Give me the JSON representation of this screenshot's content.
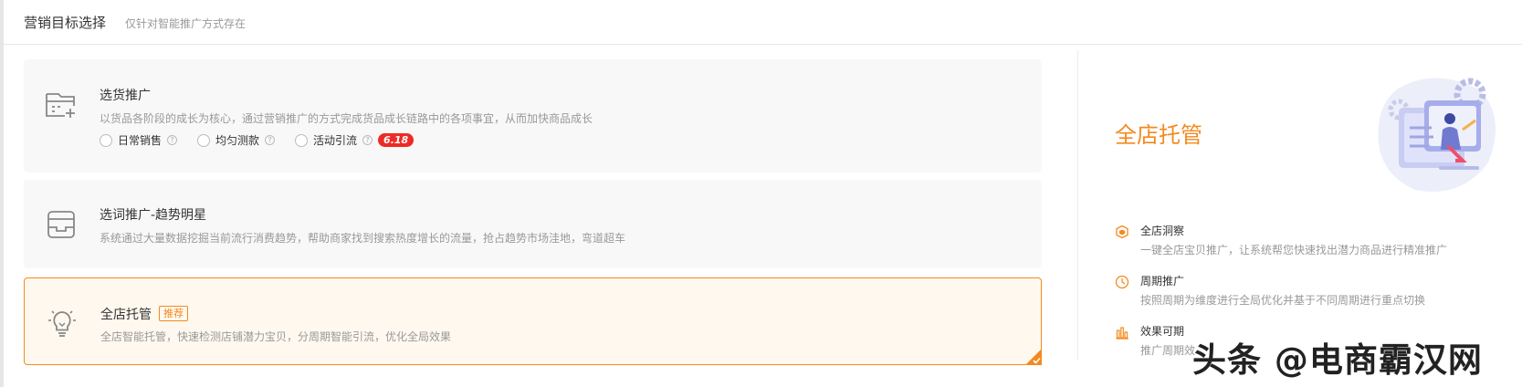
{
  "header": {
    "title": "营销目标选择",
    "subtitle": "仅针对智能推广方式存在"
  },
  "options": [
    {
      "title": "选货推广",
      "desc": "以货品各阶段的成长为核心，通过营销推广的方式完成货品成长链路中的各项事宜，从而加快商品成长",
      "icon": "calendar-add-icon",
      "radios": [
        {
          "label": "日常销售"
        },
        {
          "label": "均匀测款"
        },
        {
          "label": "活动引流",
          "badge": "6.18"
        }
      ]
    },
    {
      "title": "选词推广-趋势明星",
      "desc": "系统通过大量数据挖掘当前流行消费趋势，帮助商家找到搜索热度增长的流量，抢占趋势市场洼地，弯道超车",
      "icon": "inbox-tray-icon"
    },
    {
      "title": "全店托管",
      "tag": "推荐",
      "desc": "全店智能托管，快速检测店铺潜力宝贝，分周期智能引流，优化全局效果",
      "icon": "lightbulb-icon",
      "selected": true
    }
  ],
  "detail": {
    "title": "全店托管",
    "features": [
      {
        "title": "全店洞察",
        "desc": "一键全店宝贝推广，让系统帮您快速找出潜力商品进行精准推广",
        "icon": "cube-icon"
      },
      {
        "title": "周期推广",
        "desc": "按照周期为维度进行全局优化并基于不同周期进行重点切换",
        "icon": "clock-icon"
      },
      {
        "title": "效果可期",
        "desc": "推广周期效",
        "icon": "bar-chart-icon"
      }
    ]
  },
  "watermark": "头条 @电商霸汉网",
  "colors": {
    "accent": "#f38a1f",
    "badge": "#ee2a24"
  }
}
